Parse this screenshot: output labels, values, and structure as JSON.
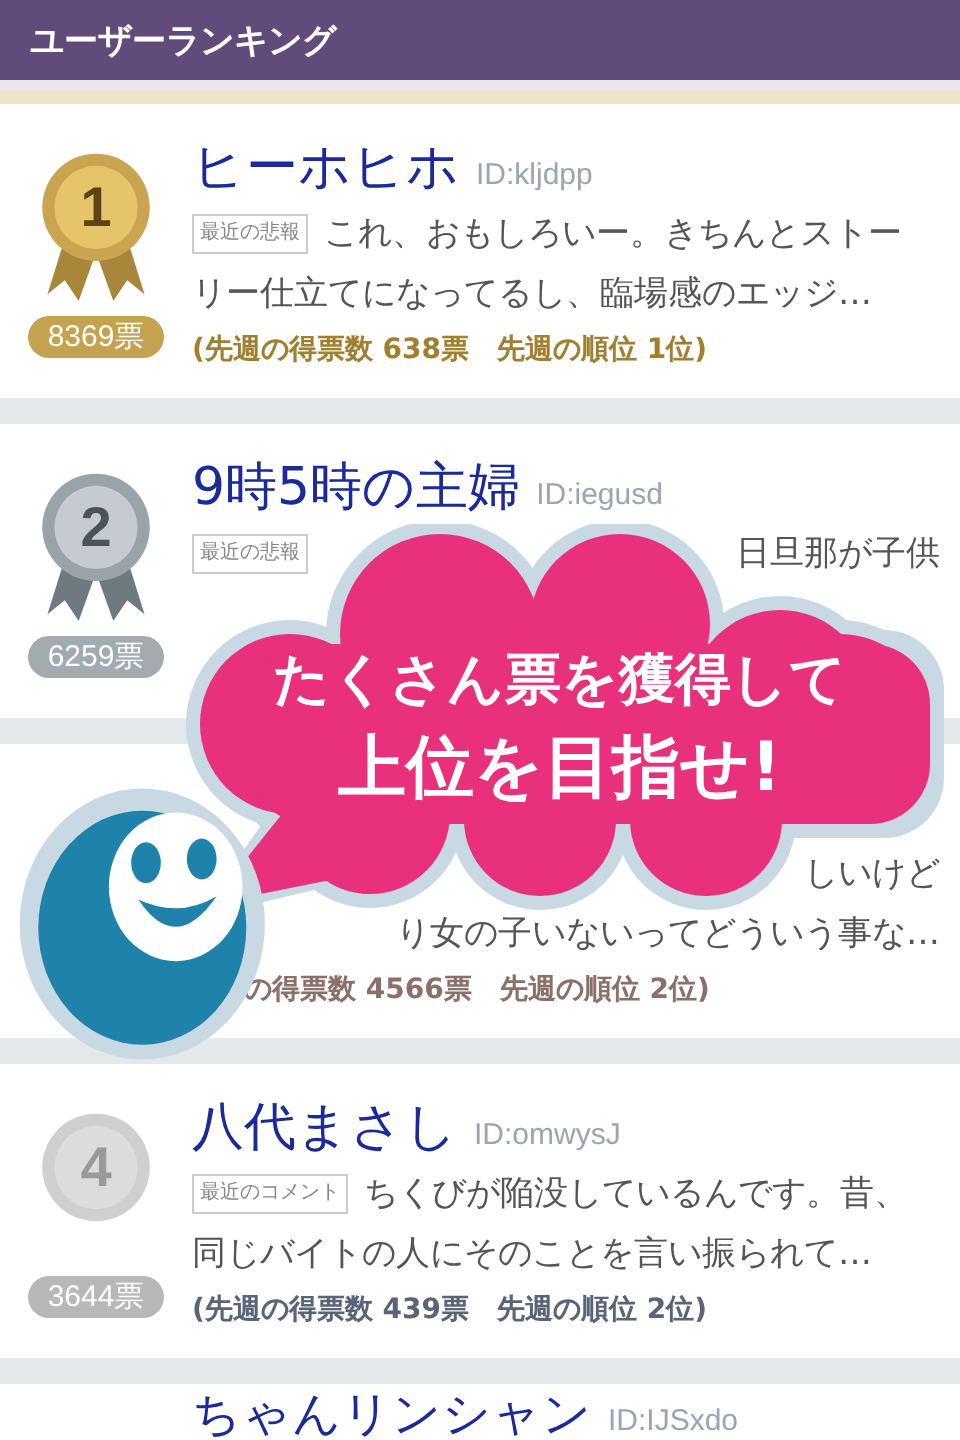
{
  "header": {
    "title": "ユーザーランキング"
  },
  "users": [
    {
      "kind": "gold",
      "rank": "1",
      "votes": "8369票",
      "name": "ヒーホヒホ",
      "user_id": "ID:kljdpp",
      "tag": "最近の悲報",
      "comment_lines": [
        "これ、おもしろいー。きちんとストー",
        "リー仕立てになってるし、臨場感のエッジ…"
      ],
      "stats": "(先週の得票数 638票　先週の順位 1位)"
    },
    {
      "kind": "silver",
      "rank": "2",
      "votes": "6259票",
      "name": "9時5時の主婦",
      "user_id": "ID:iegusd",
      "tag": "最近の悲報",
      "comment_lines": [
        "日旦那が子供"
      ],
      "covered": true
    },
    {
      "kind": "bronze",
      "comment_lines": [
        "しいけど",
        "り女の子いないってどういう事な…"
      ],
      "covered": true,
      "stats": "の得票数 4566票　先週の順位 2位)"
    },
    {
      "kind": "plain",
      "rank": "4",
      "votes": "3644票",
      "name": "八代まさし",
      "user_id": "ID:omwysJ",
      "tag": "最近のコメント",
      "comment_lines": [
        "ちくびが陥没しているんです。昔、",
        "同じバイトの人にそのことを言い振られて…"
      ],
      "stats": "(先週の得票数 439票　先週の順位 2位)"
    },
    {
      "kind": "plain",
      "name": "ちゃんリンシャン",
      "user_id": "ID:IJSxdo"
    }
  ],
  "bubble": {
    "lines": [
      "たくさん票を獲得して",
      "上位を目指せ!"
    ]
  }
}
